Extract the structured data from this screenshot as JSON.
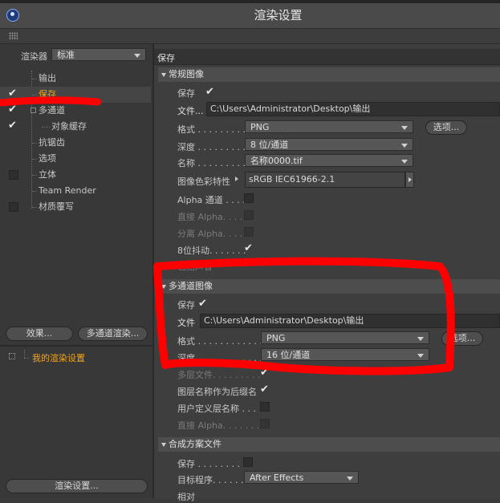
{
  "window": {
    "title": "渲染设置"
  },
  "left": {
    "renderer_label": "渲染器",
    "renderer_value": "标准",
    "tree": [
      {
        "label": "输出",
        "checked": false,
        "has_checkbox": false
      },
      {
        "label": "保存",
        "checked": true,
        "has_checkbox": true,
        "active": true
      },
      {
        "label": "多通道",
        "checked": true,
        "has_checkbox": true
      },
      {
        "label": "对象缓存",
        "checked": true,
        "has_checkbox": true
      },
      {
        "label": "抗锯齿",
        "checked": false,
        "has_checkbox": false
      },
      {
        "label": "选项",
        "checked": false,
        "has_checkbox": false
      },
      {
        "label": "立体",
        "checked": false,
        "has_checkbox": true
      },
      {
        "label": "Team Render",
        "checked": false,
        "has_checkbox": false
      },
      {
        "label": "材质覆写",
        "checked": false,
        "has_checkbox": true
      }
    ],
    "effects_button": "效果...",
    "multipass_button": "多通道渲染...",
    "my_render_setting": "我的渲染设置",
    "render_settings_button": "渲染设置..."
  },
  "right": {
    "header": "保存",
    "regular": {
      "title": "常规图像",
      "save_label": "保存",
      "file_label": "文件...",
      "file_value": "C:\\Users\\Administrator\\Desktop\\输出",
      "format_label": "格式 . . . . . . . . . .",
      "format_value": "PNG",
      "options_button": "选项...",
      "depth_label": "深度 . . . . . . . . . .",
      "depth_value": "8 位/通道",
      "name_label": "名称 . . . . . . . . . .",
      "name_value": "名称0000.tif",
      "color_profile_label": "图像色彩特性",
      "color_profile_value": "sRGB IEC61966-2.1",
      "alpha_label": "Alpha 通道 . . . .",
      "straight_alpha_label": "直接 Alpha. . . .",
      "separate_alpha_label": "分离 Alpha. . . .",
      "dither_label": "8位抖动. . . . . . .",
      "sound_label": "包括声音"
    },
    "multipass": {
      "title": "多通道图像",
      "save_label": "保存",
      "file_label": "文件",
      "file_value": "C:\\Users\\Administrator\\Desktop\\输出",
      "format_label": "格式 . . . . . . . . . . . .",
      "format_value": "PNG",
      "options_button": "选项...",
      "depth_label": "深度 . . . . . . . . . . . .",
      "depth_value": "16 位/通道",
      "multilayer_label": "多层文件. . . . . . . . .",
      "layer_name_suffix_label": "图层名称作为后缀名",
      "user_layer_name_label": "用户定义层名称 . . .",
      "straight_alpha_label": "直接 Alpha. . . . . . ."
    },
    "composite": {
      "title": "合成方案文件",
      "save_label": "保存 . . . . . . . . . .",
      "target_label": "目标程序. . . . . . . .",
      "target_value": "After Effects",
      "relative_label": "相对"
    }
  },
  "colors": {
    "annotation": "#ff0000",
    "active_text": "#f0a41e"
  }
}
